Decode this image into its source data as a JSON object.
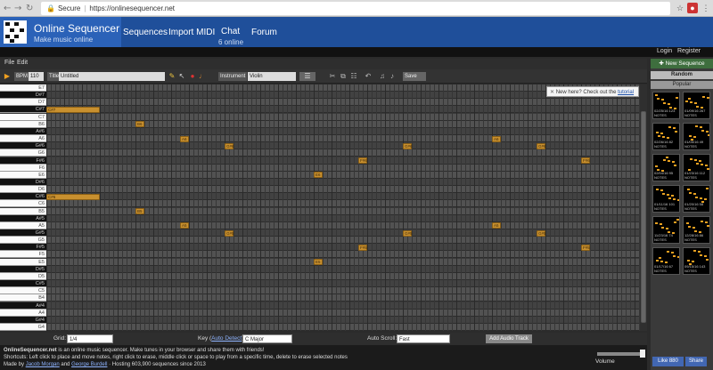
{
  "browser": {
    "secure_label": "Secure",
    "url": "https://onlinesequencer.net"
  },
  "site": {
    "title": "Online Sequencer",
    "subtitle": "Make music online",
    "nav": [
      {
        "label": "Sequences"
      },
      {
        "label": "Import MIDI"
      },
      {
        "label": "Chat",
        "sub": "6 online"
      },
      {
        "label": "Forum"
      }
    ],
    "login": "Login",
    "register": "Register"
  },
  "menu": {
    "file": "File",
    "edit": "Edit"
  },
  "toolbar": {
    "bpm_label": "BPM",
    "bpm_value": "110",
    "title_label": "Title",
    "title_value": "Untitled",
    "instrument_label": "Instrument",
    "instrument_value": "Violin",
    "save_label": "Save"
  },
  "tooltip": {
    "text": "New here? Check out the ",
    "link": "tutorial"
  },
  "piano_keys": [
    {
      "note": "E7",
      "black": false
    },
    {
      "note": "D#7",
      "black": true
    },
    {
      "note": "D7",
      "black": false
    },
    {
      "note": "C#7",
      "black": true
    },
    {
      "note": "C7",
      "black": false
    },
    {
      "note": "B6",
      "black": false
    },
    {
      "note": "A#6",
      "black": true
    },
    {
      "note": "A6",
      "black": false
    },
    {
      "note": "G#6",
      "black": true
    },
    {
      "note": "G6",
      "black": false
    },
    {
      "note": "F#6",
      "black": true
    },
    {
      "note": "F6",
      "black": false
    },
    {
      "note": "E6",
      "black": false
    },
    {
      "note": "D#6",
      "black": true
    },
    {
      "note": "D6",
      "black": false
    },
    {
      "note": "C#6",
      "black": true
    },
    {
      "note": "C6",
      "black": false
    },
    {
      "note": "B5",
      "black": false
    },
    {
      "note": "A#5",
      "black": true
    },
    {
      "note": "A5",
      "black": false
    },
    {
      "note": "G#5",
      "black": true
    },
    {
      "note": "G5",
      "black": false
    },
    {
      "note": "F#5",
      "black": true
    },
    {
      "note": "F5",
      "black": false
    },
    {
      "note": "E5",
      "black": false
    },
    {
      "note": "D#5",
      "black": true
    },
    {
      "note": "D5",
      "black": false
    },
    {
      "note": "C#5",
      "black": true
    },
    {
      "note": "C5",
      "black": false
    },
    {
      "note": "B4",
      "black": false
    },
    {
      "note": "A#4",
      "black": true
    },
    {
      "note": "A4",
      "black": false
    },
    {
      "note": "G#4",
      "black": true
    },
    {
      "note": "G4",
      "black": false
    }
  ],
  "notes": [
    {
      "pitch": "C#7",
      "start": 0,
      "length": 12
    },
    {
      "pitch": "B6",
      "start": 20,
      "length": 2
    },
    {
      "pitch": "A6",
      "start": 30,
      "length": 2
    },
    {
      "pitch": "G#6",
      "start": 40,
      "length": 2
    },
    {
      "pitch": "F#6",
      "start": 70,
      "length": 2
    },
    {
      "pitch": "E6",
      "start": 60,
      "length": 2
    },
    {
      "pitch": "G#6",
      "start": 80,
      "length": 2
    },
    {
      "pitch": "A6",
      "start": 100,
      "length": 2
    },
    {
      "pitch": "G#6",
      "start": 110,
      "length": 2
    },
    {
      "pitch": "F#6",
      "start": 120,
      "length": 2
    },
    {
      "pitch": "C#6",
      "start": 0,
      "length": 12
    },
    {
      "pitch": "B5",
      "start": 20,
      "length": 2
    },
    {
      "pitch": "A5",
      "start": 30,
      "length": 2
    },
    {
      "pitch": "G#5",
      "start": 40,
      "length": 2
    },
    {
      "pitch": "F#5",
      "start": 70,
      "length": 2
    },
    {
      "pitch": "E5",
      "start": 60,
      "length": 2
    },
    {
      "pitch": "G#5",
      "start": 80,
      "length": 2
    },
    {
      "pitch": "A5",
      "start": 100,
      "length": 2
    },
    {
      "pitch": "G#5",
      "start": 110,
      "length": 2
    },
    {
      "pitch": "F#5",
      "start": 120,
      "length": 2
    }
  ],
  "bottom": {
    "grid_label": "Grid:",
    "grid_value": "1/4",
    "key_label": "Key (",
    "key_link": "Auto Detect",
    "key_close": "):",
    "key_value": "C Major",
    "autoscroll_label": "Auto Scroll:",
    "autoscroll_value": "Fast",
    "add_audio": "Add Audio Track"
  },
  "footer": {
    "line1_bold": "OnlineSequencer.net",
    "line1_rest": " is an online music sequencer. Make tunes in your browser and share them with friends!",
    "line2": "Shortcuts: Left click to place and move notes, right click to erase, middle click or space to play from a specific time, delete to erase selected notes",
    "line3_pre": "Made by ",
    "author1": "Jacob Morgan",
    "line3_and": " and ",
    "author2": "George Burdell",
    "line3_post": " · Hosting 603,900 sequences since 2013",
    "volume": "Volume"
  },
  "sidebar": {
    "new_sequence": "New Sequence",
    "random": "Random",
    "popular": "Popular",
    "thumbs": [
      {
        "date": "02/25/16",
        "notes": "123 NOTES"
      },
      {
        "date": "01/09/16",
        "notes": "267 NOTES"
      },
      {
        "date": "02/26/16",
        "notes": "82 NOTES"
      },
      {
        "date": "01/05/16",
        "notes": "49 NOTES"
      },
      {
        "date": "02/04/16",
        "notes": "95 NOTES"
      },
      {
        "date": "01/23/16",
        "notes": "112 NOTES"
      },
      {
        "date": "01/11/16",
        "notes": "101 NOTES"
      },
      {
        "date": "01/20/16",
        "notes": "58 NOTES"
      },
      {
        "date": "11/23/16",
        "notes": "74 NOTES"
      },
      {
        "date": "12/28/16",
        "notes": "86 NOTES"
      },
      {
        "date": "01/17/16",
        "notes": "67 NOTES"
      },
      {
        "date": "09/15/16",
        "notes": "143 NOTES"
      }
    ],
    "fb_like": "Like 880",
    "fb_share": "Share"
  },
  "colors": {
    "header_blue": "#1f4f9a",
    "note_orange": "#c8902f"
  }
}
